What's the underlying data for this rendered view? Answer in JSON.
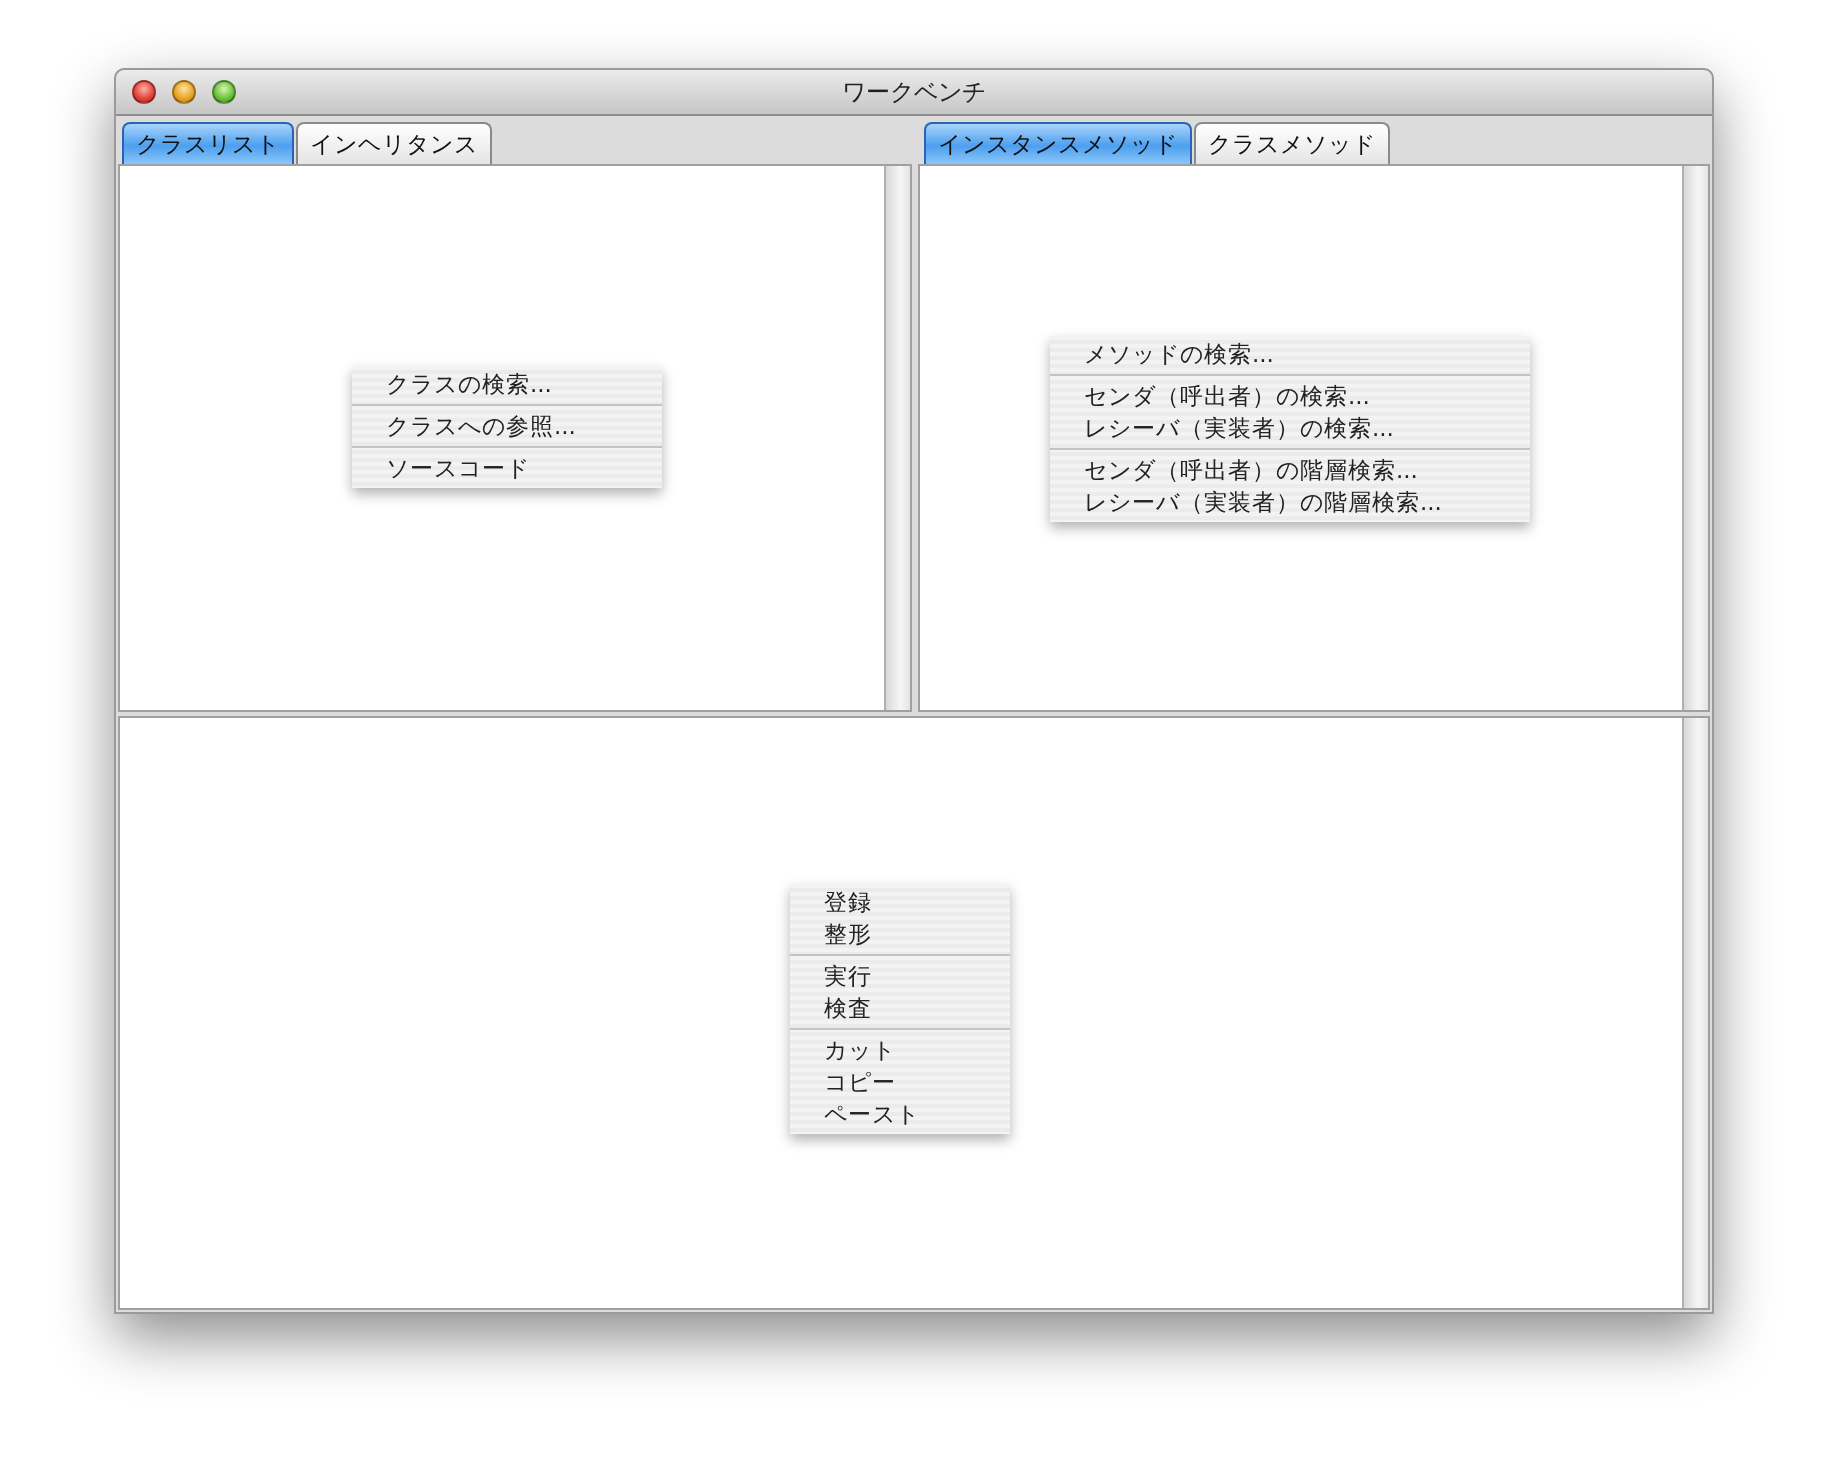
{
  "window": {
    "title": "ワークベンチ"
  },
  "left_tabs": [
    {
      "label": "クラスリスト",
      "selected": true
    },
    {
      "label": "インヘリタンス",
      "selected": false
    }
  ],
  "right_tabs": [
    {
      "label": "インスタンスメソッド",
      "selected": true
    },
    {
      "label": "クラスメソッド",
      "selected": false
    }
  ],
  "class_menu": [
    [
      "クラスの検索..."
    ],
    [
      "クラスへの参照..."
    ],
    [
      "ソースコード"
    ]
  ],
  "method_menu": [
    [
      "メソッドの検索..."
    ],
    [
      "センダ（呼出者）の検索...",
      "レシーバ（実装者）の検索..."
    ],
    [
      "センダ（呼出者）の階層検索...",
      "レシーバ（実装者）の階層検索..."
    ]
  ],
  "editor_menu": [
    [
      "登録",
      "整形"
    ],
    [
      "実行",
      "検査"
    ],
    [
      "カット",
      "コピー",
      "ペースト"
    ]
  ]
}
